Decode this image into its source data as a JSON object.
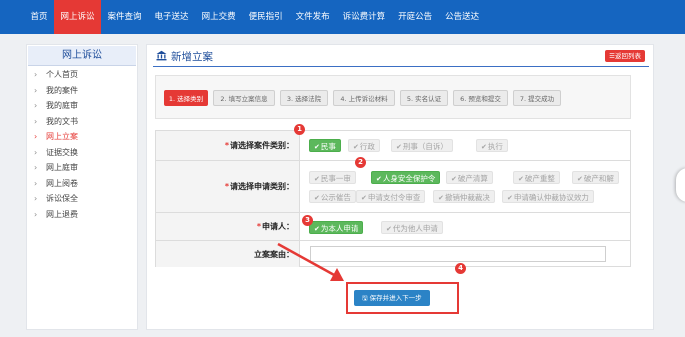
{
  "topnav": {
    "items": [
      {
        "label": "首页",
        "active": false
      },
      {
        "label": "网上诉讼",
        "active": true
      },
      {
        "label": "案件查询",
        "active": false
      },
      {
        "label": "电子送达",
        "active": false
      },
      {
        "label": "网上交费",
        "active": false
      },
      {
        "label": "便民指引",
        "active": false
      },
      {
        "label": "文件发布",
        "active": false
      },
      {
        "label": "诉讼费计算",
        "active": false
      },
      {
        "label": "开庭公告",
        "active": false
      },
      {
        "label": "公告送达",
        "active": false
      }
    ]
  },
  "sidebar": {
    "title": "网上诉讼",
    "arrow": "›",
    "items": [
      {
        "label": "个人首页",
        "active": false
      },
      {
        "label": "我的案件",
        "active": false
      },
      {
        "label": "我的庭审",
        "active": false
      },
      {
        "label": "我的文书",
        "active": false
      },
      {
        "label": "网上立案",
        "active": true
      },
      {
        "label": "证据交换",
        "active": false
      },
      {
        "label": "网上庭审",
        "active": false
      },
      {
        "label": "网上阅卷",
        "active": false
      },
      {
        "label": "诉讼保全",
        "active": false
      },
      {
        "label": "网上退费",
        "active": false
      }
    ]
  },
  "main": {
    "title": "新增立案",
    "title_icon": "bank-icon",
    "back_button": "☰返回列表",
    "steps": [
      {
        "label": "1. 选择类别",
        "active": true
      },
      {
        "label": "2. 填写立案信息",
        "active": false
      },
      {
        "label": "3. 选择法院",
        "active": false
      },
      {
        "label": "4. 上传诉讼材料",
        "active": false
      },
      {
        "label": "5. 实名认证",
        "active": false
      },
      {
        "label": "6. 预览和提交",
        "active": false
      },
      {
        "label": "7. 提交成功",
        "active": false
      }
    ],
    "form": {
      "case_type": {
        "required_mark": "*",
        "label": "请选择案件类别：",
        "options": [
          {
            "label": "民事",
            "selected": true
          },
          {
            "label": "行政",
            "selected": false
          },
          {
            "label": "刑事（自诉）",
            "selected": false
          },
          {
            "label": "执行",
            "selected": false
          }
        ]
      },
      "apply_type": {
        "required_mark": "*",
        "label": "请选择申请类别：",
        "options": [
          {
            "label": "民事一审",
            "selected": false
          },
          {
            "label": "人身安全保护令",
            "selected": true
          },
          {
            "label": "破产清算",
            "selected": false
          },
          {
            "label": "破产重整",
            "selected": false
          },
          {
            "label": "破产和解",
            "selected": false
          },
          {
            "label": "公示催告",
            "selected": false
          },
          {
            "label": "申请支付令审查",
            "selected": false
          },
          {
            "label": "撤销仲裁裁决",
            "selected": false
          },
          {
            "label": "申请确认仲裁协议效力",
            "selected": false
          }
        ]
      },
      "applicant": {
        "required_mark": "*",
        "label": "申请人：",
        "options": [
          {
            "label": "为本人申请",
            "selected": true
          },
          {
            "label": "代为他人申请",
            "selected": false
          }
        ]
      },
      "reason": {
        "label": "立案案由：",
        "value": "",
        "placeholder": ""
      }
    },
    "save_button": "🖫 保存并进入下一步"
  },
  "annotations": {
    "badges": [
      "1",
      "2",
      "3",
      "4"
    ],
    "color": "#e53935"
  },
  "check_mark": "✔",
  "colors": {
    "nav_blue": "#1565c0",
    "accent_red": "#e53935",
    "selected_green": "#5cb85c",
    "button_blue": "#2b83c6"
  }
}
